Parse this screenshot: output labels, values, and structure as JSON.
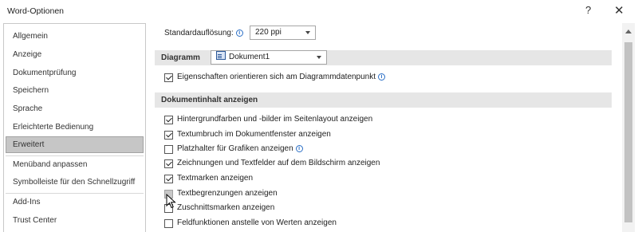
{
  "window": {
    "title": "Word-Optionen",
    "help_label": "?",
    "close_label": "✕"
  },
  "sidebar": {
    "items": [
      {
        "label": "Allgemein"
      },
      {
        "label": "Anzeige"
      },
      {
        "label": "Dokumentprüfung"
      },
      {
        "label": "Speichern"
      },
      {
        "label": "Sprache"
      },
      {
        "label": "Erleichterte Bedienung"
      },
      {
        "label": "Erweitert"
      },
      {
        "label": "Menüband anpassen"
      },
      {
        "label": "Symbolleiste für den Schnellzugriff"
      },
      {
        "label": "Add-Ins"
      },
      {
        "label": "Trust Center"
      }
    ],
    "selected": "Erweitert"
  },
  "content": {
    "resolution": {
      "label": "Standardauflösung:",
      "value": "220 ppi"
    },
    "diagram_section": {
      "title": "Diagramm",
      "document_value": "Dokument1",
      "option": {
        "label": "Eigenschaften orientieren sich am Diagrammdatenpunkt",
        "checked": true
      }
    },
    "document_content_section": {
      "title": "Dokumentinhalt anzeigen",
      "options": [
        {
          "label": "Hintergrundfarben und -bilder im Seitenlayout anzeigen",
          "checked": true
        },
        {
          "label": "Textumbruch im Dokumentfenster anzeigen",
          "checked": true
        },
        {
          "label": "Platzhalter für Grafiken anzeigen",
          "checked": false
        },
        {
          "label": "Zeichnungen und Textfelder auf dem Bildschirm anzeigen",
          "checked": true
        },
        {
          "label": "Textmarken anzeigen",
          "checked": true
        },
        {
          "label": "Textbegrenzungen anzeigen",
          "checked": false
        },
        {
          "label": "Zuschnittsmarken anzeigen",
          "checked": false
        },
        {
          "label": "Feldfunktionen anstelle von Werten anzeigen",
          "checked": false
        }
      ]
    }
  },
  "icons": {
    "info": "info-icon",
    "document": "word-document-icon"
  }
}
